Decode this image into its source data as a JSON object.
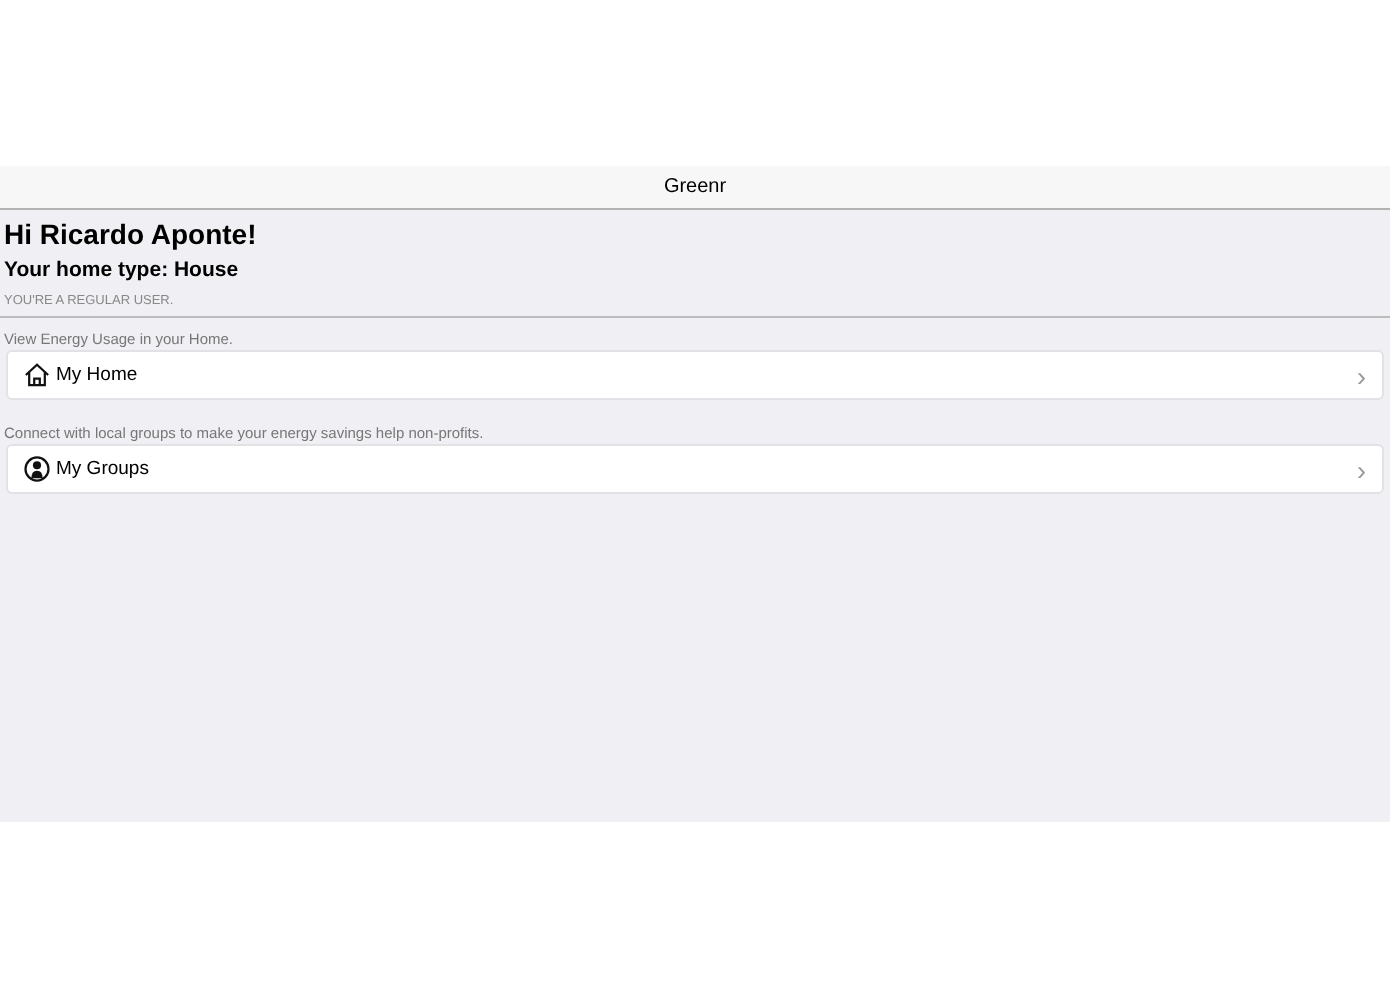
{
  "navbar": {
    "title": "Greenr"
  },
  "greeting": "Hi Ricardo Aponte!",
  "home_type": "Your home type: House",
  "user_level": "YOU'RE A REGULAR USER.",
  "sections": [
    {
      "caption": "View Energy Usage in your Home.",
      "item": {
        "kind": "home",
        "label": "My Home",
        "chevron": "›"
      }
    },
    {
      "caption": "Connect with local groups to make your energy savings help non-profits.",
      "item": {
        "kind": "groups",
        "label": "My Groups",
        "chevron": "›"
      }
    }
  ]
}
